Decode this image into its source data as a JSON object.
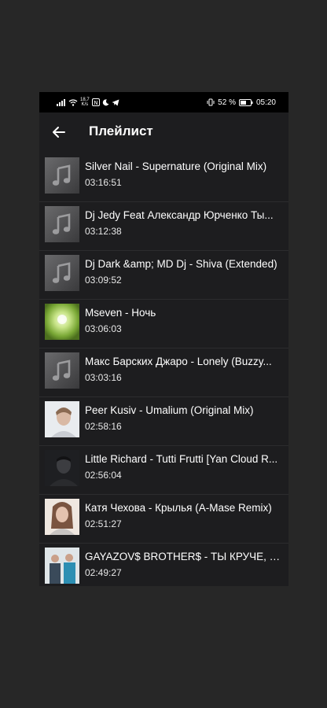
{
  "status_bar": {
    "net_speed_value": "18,7",
    "net_speed_unit": "K/s",
    "battery_percent": "52 %",
    "time": "05:20"
  },
  "app_bar": {
    "title": "Плейлист",
    "back_icon": "arrow-left-icon"
  },
  "tracks": [
    {
      "title": "Silver Nail - Supernature (Original Mix)",
      "duration": "03:16:51",
      "art": "music-note-placeholder"
    },
    {
      "title": "Dj Jedy Feat Александр Юрченко Ты...",
      "duration": "03:12:38",
      "art": "music-note-placeholder"
    },
    {
      "title": "Dj Dark &amp; MD Dj - Shiva (Extended)",
      "duration": "03:09:52",
      "art": "music-note-placeholder"
    },
    {
      "title": "Mseven - Ночь",
      "duration": "03:06:03",
      "art": "cover-green-glow"
    },
    {
      "title": "Макс Барских Джаро - Lonely (Buzzy...",
      "duration": "03:03:16",
      "art": "music-note-placeholder"
    },
    {
      "title": "Peer Kusiv - Umalium (Original Mix)",
      "duration": "02:58:16",
      "art": "cover-portrait-light"
    },
    {
      "title": "Little Richard - Tutti Frutti [Yan Cloud R...",
      "duration": "02:56:04",
      "art": "cover-dark-portrait"
    },
    {
      "title": "Катя Чехова - Крылья (A-Mase Remix)",
      "duration": "02:51:27",
      "art": "cover-woman-portrait"
    },
    {
      "title": "GAYAZOV$ BROTHER$ - ТЫ КРУЧЕ, Ч...",
      "duration": "02:49:27",
      "art": "cover-two-men"
    }
  ]
}
